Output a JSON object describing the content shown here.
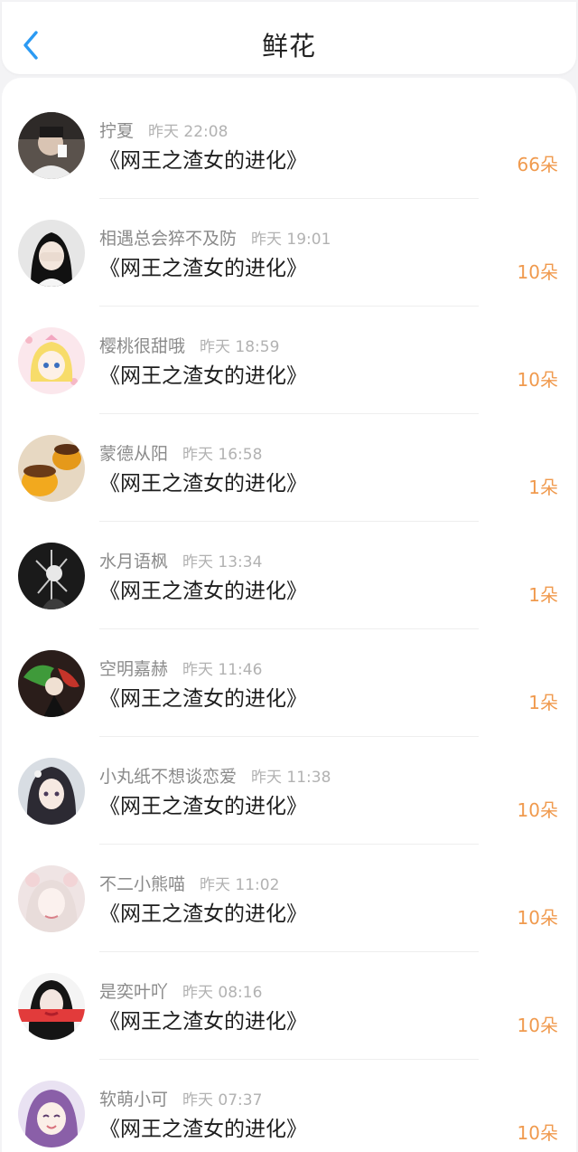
{
  "header": {
    "title": "鲜花",
    "back_icon": "chevron-left-icon",
    "back_color": "#2b9af3"
  },
  "colors": {
    "amount": "#f09a4e",
    "username": "#8a8a8a",
    "time": "#b2b2b2"
  },
  "items": [
    {
      "user": "拧夏",
      "time": "昨天 22:08",
      "book": "《网王之渣女的进化》",
      "amount": "66朵"
    },
    {
      "user": "相遇总会猝不及防",
      "time": "昨天 19:01",
      "book": "《网王之渣女的进化》",
      "amount": "10朵"
    },
    {
      "user": "樱桃很甜哦",
      "time": "昨天 18:59",
      "book": "《网王之渣女的进化》",
      "amount": "10朵"
    },
    {
      "user": "蒙德从阳",
      "time": "昨天 16:58",
      "book": "《网王之渣女的进化》",
      "amount": "1朵"
    },
    {
      "user": "水月语枫",
      "time": "昨天 13:34",
      "book": "《网王之渣女的进化》",
      "amount": "1朵"
    },
    {
      "user": "空明嘉赫",
      "time": "昨天 11:46",
      "book": "《网王之渣女的进化》",
      "amount": "1朵"
    },
    {
      "user": "小丸纸不想谈恋爱",
      "time": "昨天 11:38",
      "book": "《网王之渣女的进化》",
      "amount": "10朵"
    },
    {
      "user": "不二小熊喵",
      "time": "昨天 11:02",
      "book": "《网王之渣女的进化》",
      "amount": "10朵"
    },
    {
      "user": "是奕叶吖",
      "time": "昨天 08:16",
      "book": "《网王之渣女的进化》",
      "amount": "10朵"
    },
    {
      "user": "软萌小可",
      "time": "昨天 07:37",
      "book": "《网王之渣女的进化》",
      "amount": "10朵"
    }
  ]
}
